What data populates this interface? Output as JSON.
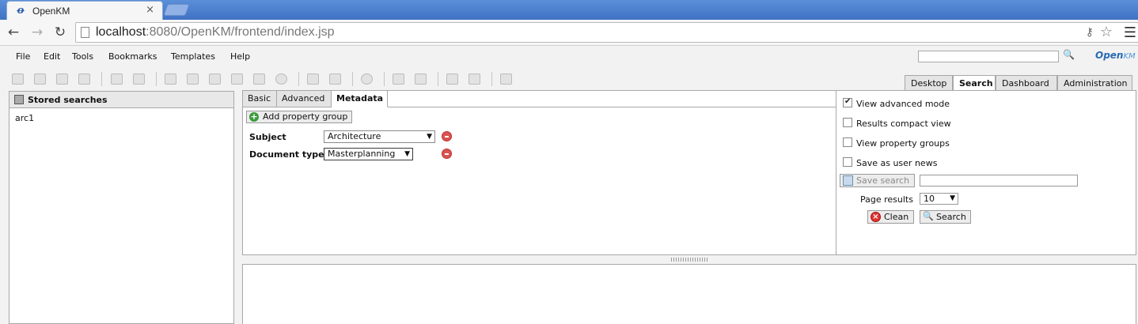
{
  "browser": {
    "tab_title": "OpenKM",
    "tab_close": "×",
    "favicon_glyph": "ꝋ",
    "url_host": "localhost",
    "url_rest": ":8080/OpenKM/frontend/index.jsp"
  },
  "menu": {
    "items": [
      "File",
      "Edit",
      "Tools",
      "Bookmarks",
      "Templates",
      "Help"
    ]
  },
  "logo": {
    "main": "Open",
    "suffix": "KM"
  },
  "main_tabs": [
    "Desktop",
    "Search",
    "Dashboard",
    "Administration"
  ],
  "left_panel": {
    "title": "Stored searches",
    "items": [
      "arc1"
    ]
  },
  "search_tabs": [
    "Basic",
    "Advanced",
    "Metadata"
  ],
  "metadata": {
    "add_group_label": "Add property group",
    "properties": [
      {
        "label": "Subject",
        "value": "Architecture"
      },
      {
        "label": "Document type",
        "value": "Masterplanning"
      }
    ]
  },
  "options": {
    "view_advanced": {
      "label": "View advanced mode",
      "checked": true
    },
    "compact_view": {
      "label": "Results compact view",
      "checked": false
    },
    "property_groups": {
      "label": "View property groups",
      "checked": false
    },
    "user_news": {
      "label": "Save as user news",
      "checked": false
    },
    "save_search_label": "Save search",
    "page_results_label": "Page results",
    "page_results_value": "10",
    "clean_label": "Clean",
    "search_label": "Search"
  },
  "icons": {
    "back": "back-arrow-icon",
    "forward": "forward-arrow-icon",
    "reload": "reload-icon",
    "star": "bookmark-star-icon",
    "menu": "chrome-menu-icon"
  }
}
